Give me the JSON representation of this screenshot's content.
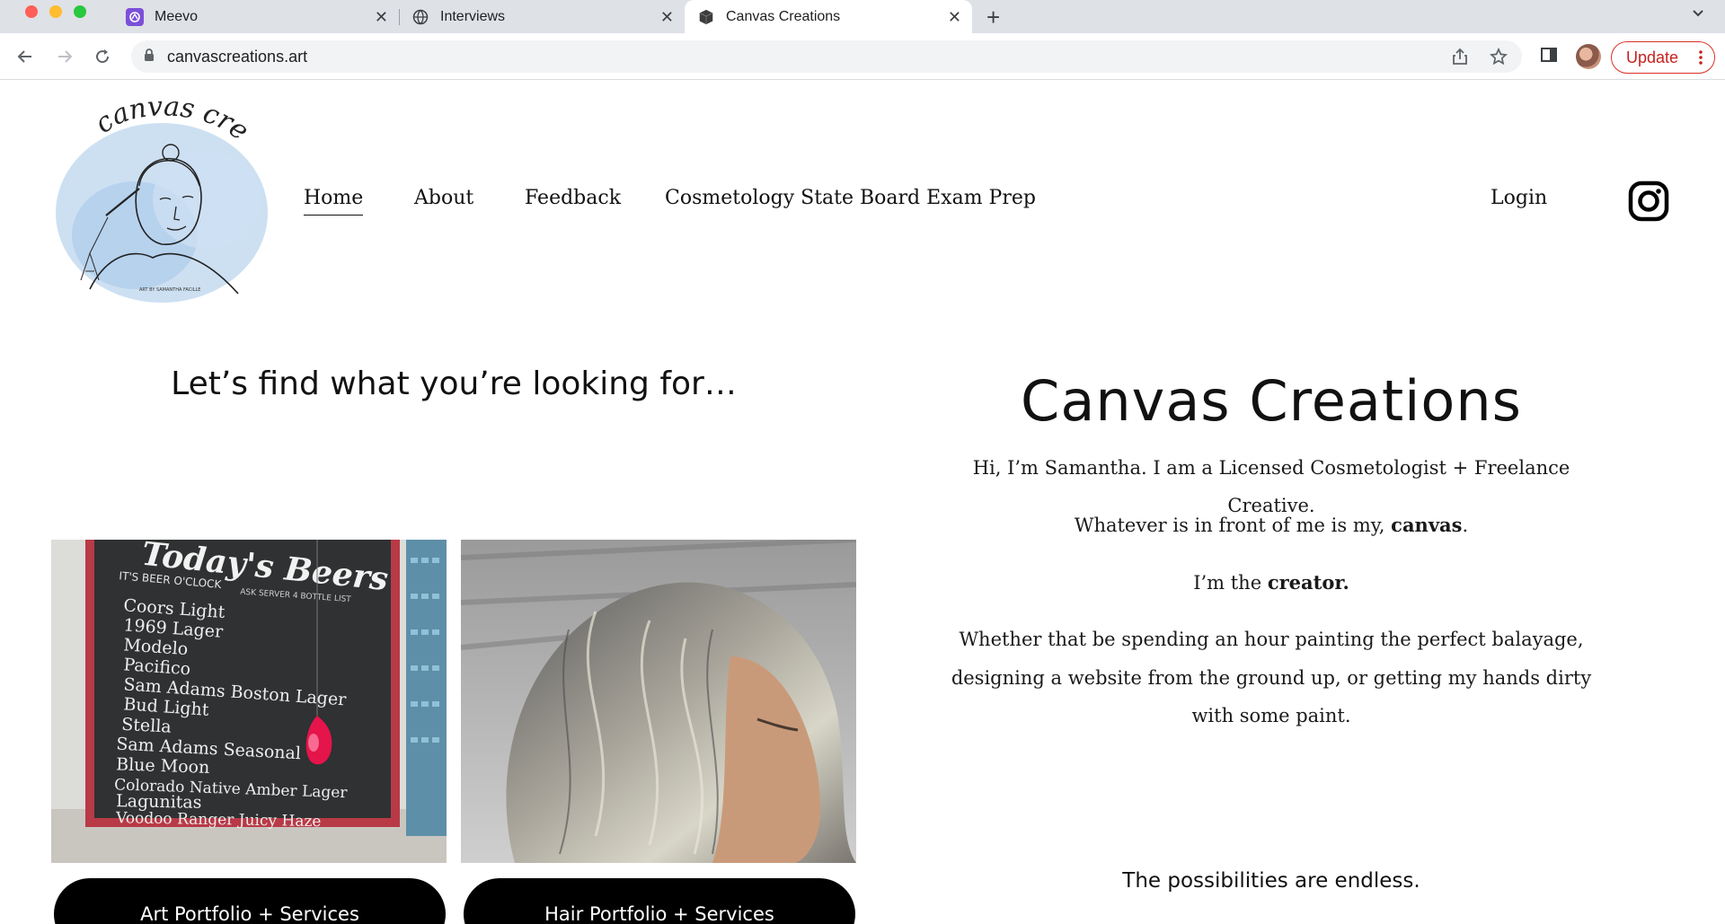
{
  "browser": {
    "tabs": [
      {
        "title": "Meevo",
        "favicon": "meevo-icon"
      },
      {
        "title": "Interviews",
        "favicon": "globe-icon"
      },
      {
        "title": "Canvas Creations",
        "favicon": "cube-icon",
        "active": true
      }
    ],
    "url": "canvascreations.art",
    "update_label": "Update",
    "accent": "#c5221f"
  },
  "site": {
    "logo_text": "canvas creations",
    "logo_caption": "ART BY SAMANTHA FACILLE",
    "nav": [
      {
        "label": "Home",
        "active": true
      },
      {
        "label": "About"
      },
      {
        "label": "Feedback"
      },
      {
        "label": "Cosmetology State Board Exam Prep"
      }
    ],
    "login_label": "Login",
    "social_icon": "instagram-icon"
  },
  "left": {
    "heading": "Let’s find what you’re looking for…",
    "chalkboard": {
      "title": "Today's Beers",
      "subtitle": "IT'S BEER O'CLOCK",
      "note": "ASK SERVER 4 BOTTLE LIST",
      "items": [
        "Coors Light",
        "1969 Lager",
        "Modelo",
        "Pacifico",
        "Sam Adams Boston Lager",
        "Bud Light",
        "Stella",
        "Sam Adams Seasonal",
        "Blue Moon",
        "Colorado Native Amber Lager",
        "Lagunitas",
        "Voodoo Ranger Juicy Haze"
      ]
    },
    "buttons": [
      "Art Portfolio + Services",
      "Hair Portfolio + Services"
    ]
  },
  "right": {
    "title": "Canvas Creations",
    "intro": "Hi, I’m Samantha. I am a Licensed Cosmetologist + Freelance Creative.",
    "line2_pre": "Whatever is in front of me is my, ",
    "line2_bold": "canvas",
    "line2_post": ".",
    "line3_pre": "I’m the ",
    "line3_bold": "creator.",
    "para1": "Whether that be spending an hour painting the perfect balayage,",
    "para2": "designing a website from the ground up, or getting my hands dirty",
    "para3": "with some paint.",
    "closing": "The possibilities are endless."
  }
}
